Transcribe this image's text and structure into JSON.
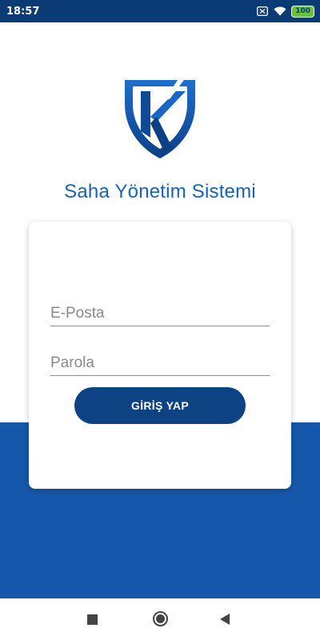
{
  "status_bar": {
    "time": "18:57",
    "battery": "100",
    "icons": [
      "sim-off-icon",
      "wifi-icon",
      "battery-icon"
    ]
  },
  "app": {
    "logo_letter": "K",
    "title": "Saha Yönetim Sistemi"
  },
  "login": {
    "email_placeholder": "E-Posta",
    "email_value": "",
    "password_placeholder": "Parola",
    "password_value": "",
    "submit_label": "GİRİŞ YAP"
  },
  "nav_bar": {
    "icons": [
      "recent-apps-icon",
      "home-icon",
      "back-icon"
    ]
  },
  "colors": {
    "status_bar": "#0b3b75",
    "brand_blue": "#1763b8",
    "background_blue": "#1557aa",
    "button": "#0d4283"
  }
}
